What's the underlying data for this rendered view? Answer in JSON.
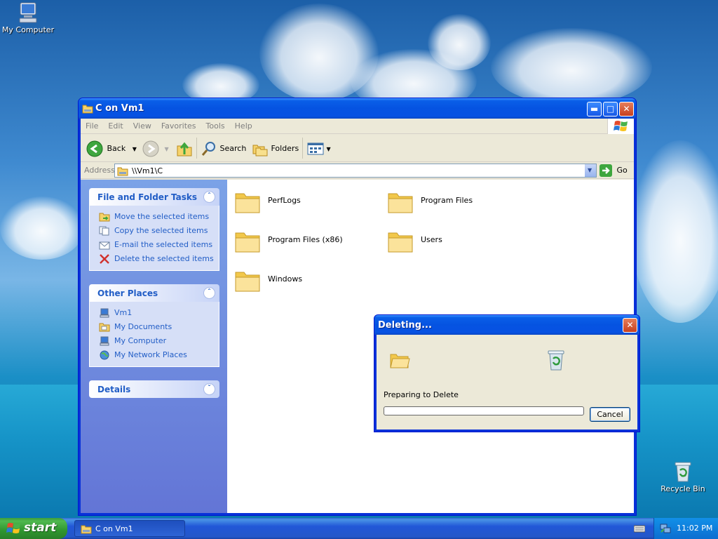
{
  "desktop": {
    "icons": [
      {
        "label": "My Computer"
      },
      {
        "label": "Recycle Bin"
      }
    ]
  },
  "window": {
    "title": "C on Vm1",
    "menu": [
      "File",
      "Edit",
      "View",
      "Favorites",
      "Tools",
      "Help"
    ],
    "toolbar": {
      "back_label": "Back",
      "search_label": "Search",
      "folders_label": "Folders"
    },
    "address": {
      "label": "Address",
      "value": "\\\\Vm1\\C",
      "go_label": "Go"
    },
    "tasks": {
      "file_folder": {
        "title": "File and Folder Tasks",
        "items": [
          {
            "label": "Move the selected items"
          },
          {
            "label": "Copy the selected items"
          },
          {
            "label": "E-mail the selected items"
          },
          {
            "label": "Delete the selected items"
          }
        ]
      },
      "other_places": {
        "title": "Other Places",
        "items": [
          {
            "label": "Vm1"
          },
          {
            "label": "My Documents"
          },
          {
            "label": "My Computer"
          },
          {
            "label": "My Network Places"
          }
        ]
      },
      "details": {
        "title": "Details"
      }
    },
    "folders": [
      {
        "name": "PerfLogs"
      },
      {
        "name": "Program Files"
      },
      {
        "name": "Program Files (x86)"
      },
      {
        "name": "Users"
      },
      {
        "name": "Windows"
      }
    ]
  },
  "dialog": {
    "title": "Deleting...",
    "status": "Preparing to Delete",
    "progress": 0,
    "cancel_label": "Cancel"
  },
  "taskbar": {
    "start_label": "start",
    "task_title": "C on Vm1",
    "clock": "11:02 PM"
  },
  "colors": {
    "link_blue": "#215dc6",
    "title_blue": "#0553e1",
    "start_green": "#3c9d3c"
  }
}
